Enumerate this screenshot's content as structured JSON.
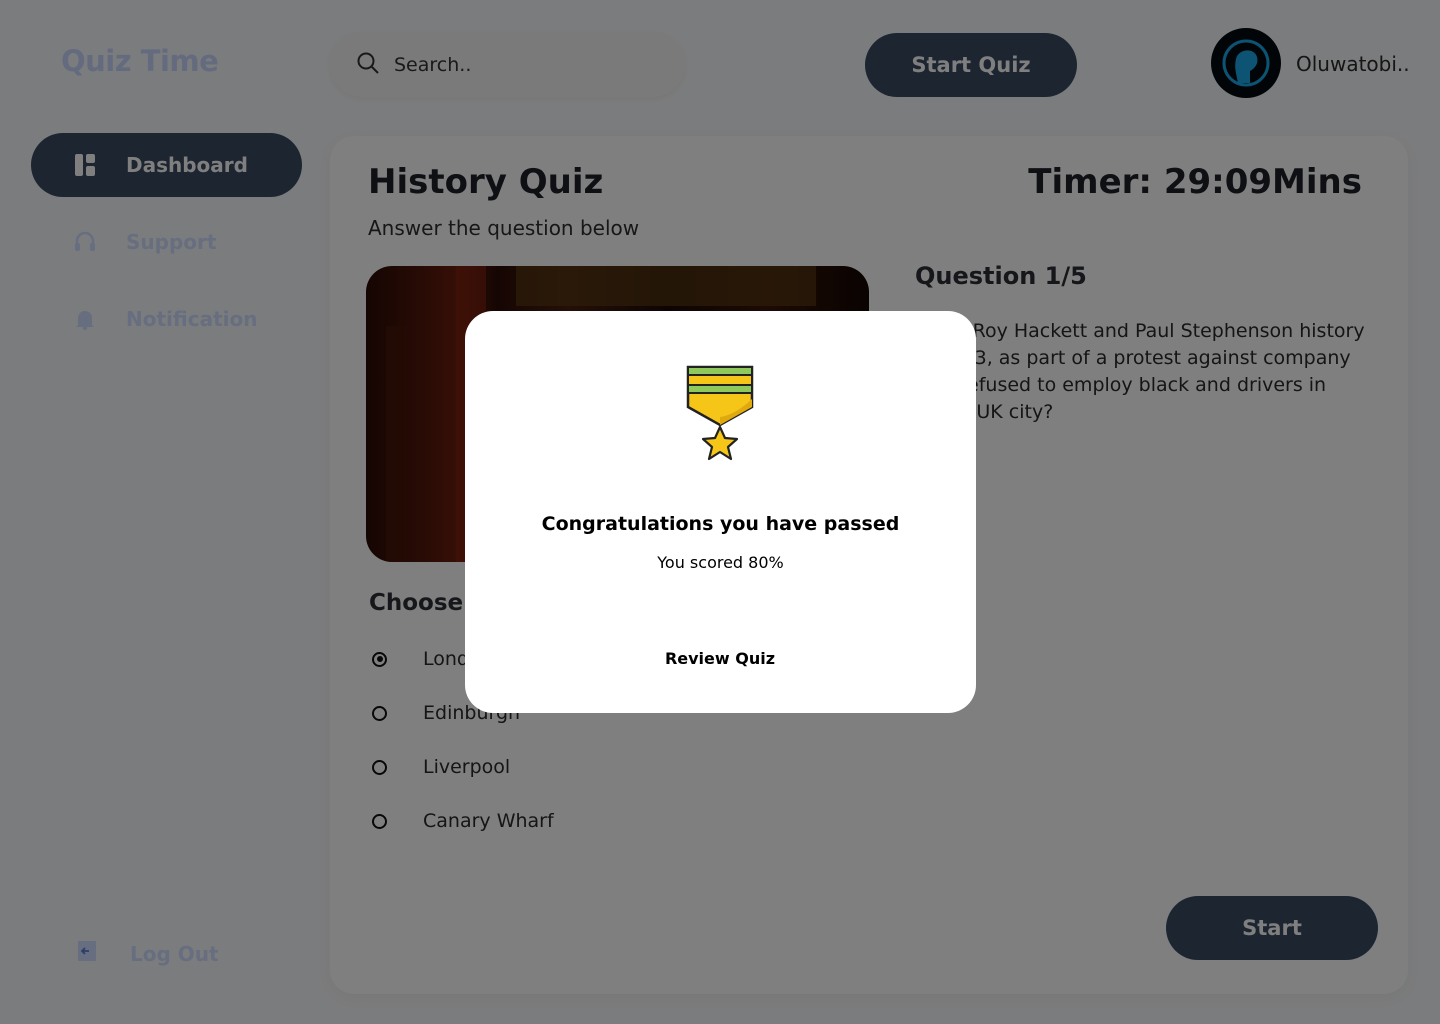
{
  "app": {
    "logo": "Quiz Time"
  },
  "sidebar": {
    "items": [
      {
        "label": "Dashboard",
        "icon": "dashboard-icon",
        "active": true
      },
      {
        "label": "Support",
        "icon": "headset-icon",
        "active": false
      },
      {
        "label": "Notification",
        "icon": "bell-icon",
        "active": false
      }
    ],
    "logout_label": "Log Out"
  },
  "header": {
    "search_placeholder": "Search..",
    "start_quiz_label": "Start Quiz",
    "username": "Oluwatobi.."
  },
  "quiz": {
    "title": "History Quiz",
    "timer": "Timer: 29:09Mins",
    "subtitle": "Answer the question below",
    "question_number": "Question 1/5",
    "question_text": "uiley, Roy Hackett and Paul Stephenson history in 1963, as part of a protest against company that refused to employ black and drivers in which UK city?",
    "choose_label": "Choose a",
    "options": [
      {
        "label": "London",
        "selected": true
      },
      {
        "label": "Edinburgh",
        "selected": false
      },
      {
        "label": "Liverpool",
        "selected": false
      },
      {
        "label": "Canary Wharf",
        "selected": false
      }
    ],
    "start_label": "Start"
  },
  "modal": {
    "title": "Congratulations you have passed",
    "score_text": "You scored 80%",
    "review_label": "Review Quiz"
  },
  "colors": {
    "primary": "#3b4a63",
    "sidebar_text": "#cfdcff",
    "medal_gold": "#f5c518",
    "medal_green": "#8fc85b"
  }
}
